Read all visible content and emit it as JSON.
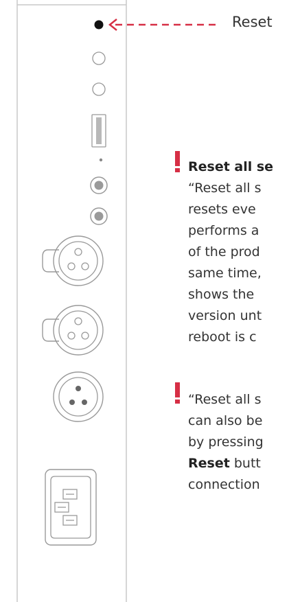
{
  "callout": {
    "reset_label": "Reset",
    "accent_color": "#d62f45"
  },
  "note1": {
    "heading": "Reset all se",
    "lines": [
      "“Reset all s",
      "resets eve",
      "performs a",
      "of the prod",
      "same time,",
      "shows the",
      "version unt",
      "reboot is c"
    ]
  },
  "note2": {
    "lines": [
      "“Reset all s",
      "can also be",
      "by pressing"
    ],
    "bold_word": "Reset",
    "line4_rest": " butt",
    "line5": "connection"
  },
  "icons": {
    "warning": "exclamation-icon",
    "panel": "rear-panel"
  }
}
